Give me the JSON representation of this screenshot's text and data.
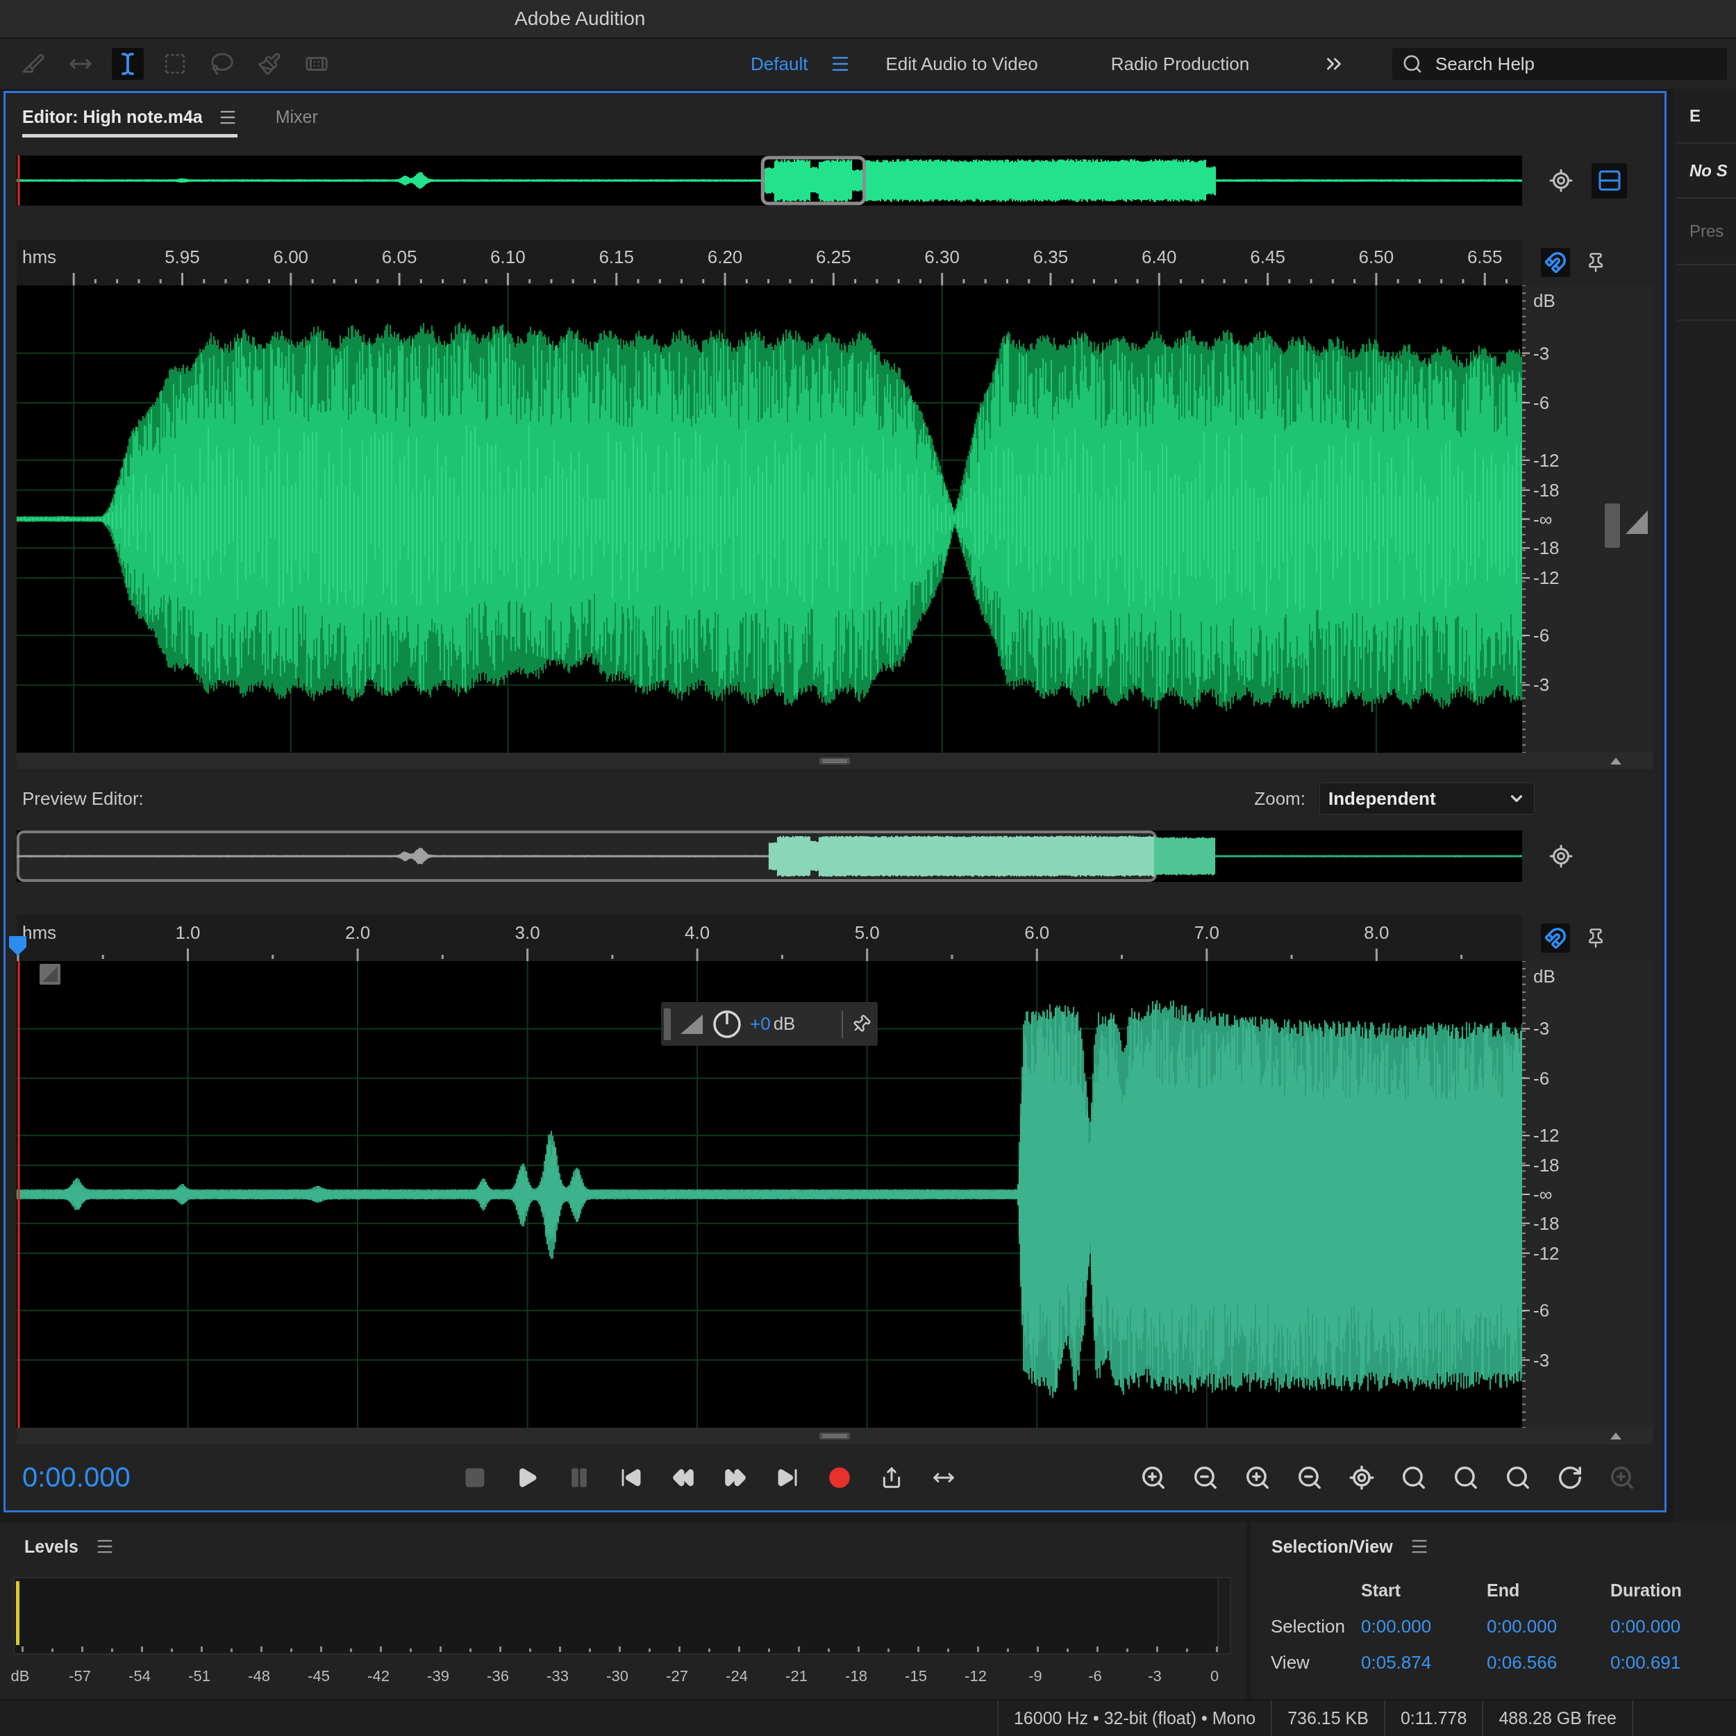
{
  "window": {
    "title": "Adobe Audition"
  },
  "toolbar": {
    "tools": [
      {
        "kind": "razor",
        "selected": false
      },
      {
        "kind": "slip",
        "selected": false
      },
      {
        "kind": "time-selection",
        "selected": true
      },
      {
        "kind": "marquee",
        "selected": false
      },
      {
        "kind": "lasso",
        "selected": false
      },
      {
        "kind": "brush",
        "selected": false
      },
      {
        "kind": "healing",
        "selected": false
      }
    ],
    "workspaces": [
      {
        "label": "Default",
        "selected": true
      },
      {
        "label": "Edit Audio to Video",
        "selected": false
      },
      {
        "label": "Radio Production",
        "selected": false
      }
    ],
    "search": {
      "placeholder": "Search Help"
    }
  },
  "editor": {
    "tabs": [
      {
        "label": "Editor: High note.m4a",
        "selected": true
      },
      {
        "label": "Mixer",
        "selected": false
      }
    ],
    "view_toggle": {
      "on": true
    },
    "main_view": {
      "ruler": {
        "unit": "hms",
        "ticks": [
          "5.95",
          "6.00",
          "6.05",
          "6.10",
          "6.15",
          "6.20",
          "6.25",
          "6.30",
          "6.35",
          "6.40",
          "6.45",
          "6.50",
          "6.55"
        ]
      },
      "snapping": {
        "on": true
      },
      "db_scale": [
        "dB",
        "-3",
        "-6",
        "-12",
        "-18",
        "-∞",
        "-18",
        "-12",
        "-6",
        "-3"
      ]
    },
    "preview": {
      "title": "Preview Editor:",
      "zoom": {
        "label": "Zoom:",
        "value": "Independent"
      },
      "ruler": {
        "unit": "hms",
        "ticks": [
          "1.0",
          "2.0",
          "3.0",
          "4.0",
          "5.0",
          "6.0",
          "7.0",
          "8.0"
        ]
      },
      "snapping": {
        "on": true
      },
      "db_scale": [
        "dB",
        "-3",
        "-6",
        "-12",
        "-18",
        "-∞",
        "-18",
        "-12",
        "-6",
        "-3"
      ],
      "hud": {
        "gain": "+0",
        "unit": "dB"
      }
    },
    "transport": {
      "time": "0:00.000",
      "buttons": [
        {
          "kind": "stop",
          "disabled": true
        },
        {
          "kind": "play",
          "disabled": false
        },
        {
          "kind": "pause",
          "disabled": true
        },
        {
          "kind": "previous",
          "disabled": false
        },
        {
          "kind": "rewind",
          "disabled": false
        },
        {
          "kind": "fast-forward",
          "disabled": false
        },
        {
          "kind": "next",
          "disabled": false
        },
        {
          "kind": "record",
          "disabled": false
        },
        {
          "kind": "loop",
          "disabled": false
        },
        {
          "kind": "skip-selection",
          "disabled": false
        }
      ],
      "zoom_buttons": [
        {
          "kind": "zoom-in-amplitude",
          "disabled": false
        },
        {
          "kind": "zoom-out-amplitude",
          "disabled": false
        },
        {
          "kind": "zoom-in-time",
          "disabled": false
        },
        {
          "kind": "zoom-out-time",
          "disabled": false
        },
        {
          "kind": "zoom-full",
          "disabled": false
        },
        {
          "kind": "zoom-in-point",
          "disabled": false
        },
        {
          "kind": "zoom-out-point",
          "disabled": false
        },
        {
          "kind": "zoom-selection",
          "disabled": false
        },
        {
          "kind": "zoom-reset",
          "disabled": false
        },
        {
          "kind": "zoom-tracks",
          "disabled": true
        }
      ]
    }
  },
  "side_panel": {
    "tab": "E",
    "items": [
      {
        "kind": "title",
        "label": "No S"
      },
      {
        "kind": "label",
        "label": "Pres"
      }
    ]
  },
  "levels": {
    "title": "Levels",
    "scale": [
      "dB",
      "-57",
      "-54",
      "-51",
      "-48",
      "-45",
      "-42",
      "-39",
      "-36",
      "-33",
      "-30",
      "-27",
      "-24",
      "-21",
      "-18",
      "-15",
      "-12",
      "-9",
      "-6",
      "-3",
      "0"
    ]
  },
  "selection_view": {
    "title": "Selection/View",
    "columns": [
      "Start",
      "End",
      "Duration"
    ],
    "rows": [
      {
        "label": "Selection",
        "values": [
          "0:00.000",
          "0:00.000",
          "0:00.000"
        ]
      },
      {
        "label": "View",
        "values": [
          "0:05.874",
          "0:06.566",
          "0:00.691"
        ]
      }
    ]
  },
  "status_bar": {
    "format": "16000 Hz • 32-bit (float) • Mono",
    "file_size": "736.15 KB",
    "duration": "0:11.778",
    "free_space": "488.28 GB free"
  }
}
